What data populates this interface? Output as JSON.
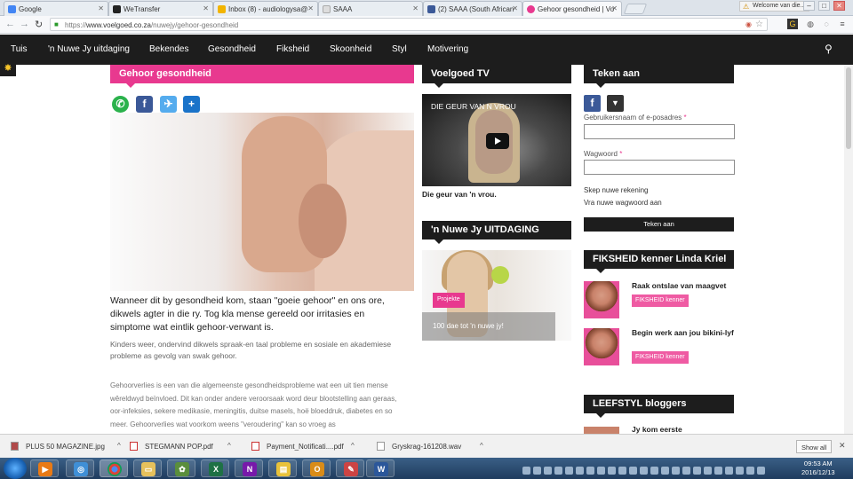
{
  "browser": {
    "tabs": [
      {
        "label": "Google",
        "color": "#4285f4"
      },
      {
        "label": "WeTransfer",
        "color": "#222222"
      },
      {
        "label": "Inbox (8) - audiologysa@",
        "color": "#f2b400"
      },
      {
        "label": "SAAA",
        "color": "#dddddd"
      },
      {
        "label": "(2) SAAA (South African",
        "color": "#3b5998"
      },
      {
        "label": "Gehoor gesondheid | Vo",
        "color": "#e8398f"
      }
    ],
    "user_chip": "Welcome van die...",
    "url_scheme": "https://",
    "url_host": "www.voelgoed.co.za",
    "url_path": "/nuwejy/gehoor-gesondheid"
  },
  "sitenav": {
    "items": [
      "Tuis",
      "'n Nuwe Jy uitdaging",
      "Bekendes",
      "Gesondheid",
      "Fiksheid",
      "Skoonheid",
      "Styl",
      "Motivering"
    ]
  },
  "article": {
    "category": "Gehoor gesondheid",
    "share": {
      "whatsapp": "whatsapp-icon",
      "facebook": "f",
      "twitter": "twitter-icon",
      "add": "+"
    },
    "lead": "Wanneer dit by gesondheid kom, staan \"goeie gehoor\" en ons ore, dikwels agter in die ry. Tog kla mense gereeld oor irritasies en simptome wat eintlik gehoor-verwant is.",
    "sub": "Kinders weer, ondervind dikwels spraak-en taal probleme en sosiale en akademiese probleme as gevolg van swak gehoor.",
    "body": "Gehoorverlies is een van die algemeenste gesondheidsprobleme wat een uit tien mense wêreldwyd beïnvloed. Dit kan onder andere veroorsaak word deur blootstelling aan geraas, oor-infeksies, sekere medikasie, meningitis, duitse masels, hoë bloeddruk, diabetes en so meer. Gehoorverlies wat voorkom weens \"veroudering\" kan so vroeg as"
  },
  "middle": {
    "tv_heading": "Voelgoed TV",
    "video_title": "DIE GEUR VAN N VROU",
    "video_caption": "Die geur van 'n vrou.",
    "challenge_heading": "'n Nuwe Jy UITDAGING",
    "challenge_tag": "Projekte",
    "challenge_caption": "100 dae tot 'n nuwe jy!"
  },
  "right": {
    "signup_heading": "Teken aan",
    "facebook_glyph": "f",
    "username_label": "Gebruikersnaam of e-posadres",
    "password_label": "Wagwoord",
    "required_mark": "*",
    "create_account": "Skep nuwe rekening",
    "forgot_password": "Vra nuwe wagwoord aan",
    "submit": "Teken aan",
    "fitness_heading": "FIKSHEID kenner Linda Kriel",
    "fitness_items": [
      {
        "title": "Raak ontslae van maagvet",
        "tag": "FIKSHEID kenner"
      },
      {
        "title": "Begin werk aan jou bikini-lyf",
        "tag": "FIKSHEID kenner"
      }
    ],
    "bloggers_heading": "LEEFSTYL bloggers",
    "blogger_line": "Jy kom eerste"
  },
  "downloads": {
    "files": [
      "PLUS 50 MAGAZINE.jpg",
      "STEGMANN POP.pdf",
      "Payment_Notificati....pdf",
      "Gryskrag-161208.wav"
    ],
    "show_all": "Show all"
  },
  "taskbar": {
    "time": "09:53 AM",
    "date": "2016/12/13"
  },
  "colors": {
    "accent_pink": "#e8398f",
    "nav_dark": "#1d1d1d"
  }
}
